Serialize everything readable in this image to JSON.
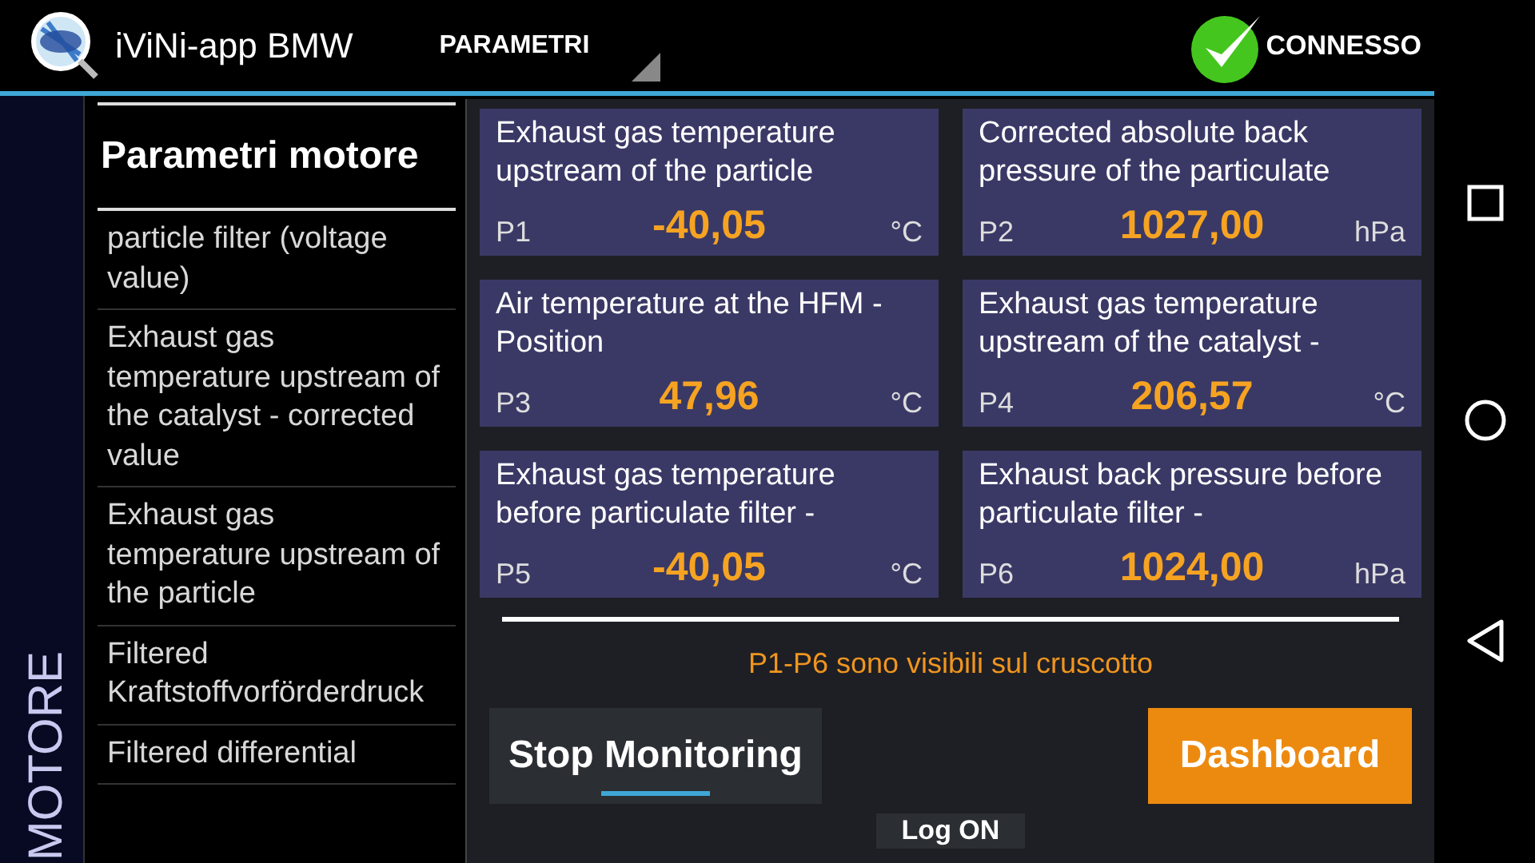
{
  "app_bar": {
    "title": "iViNi-app BMW",
    "menu": "PARAMETRI",
    "status": "CONNESSO"
  },
  "side_tab": "MOTORE",
  "list": {
    "header": "Parametri motore",
    "items": [
      {
        "label": "particle filter (voltage value)"
      },
      {
        "label": "Exhaust gas temperature upstream of the catalyst - corrected value"
      },
      {
        "label": "Exhaust gas temperature upstream of the particle"
      },
      {
        "label": "Filtered Kraftstoffvorförderdruck"
      },
      {
        "label": "Filtered differential"
      }
    ]
  },
  "cards": [
    {
      "name": "Exhaust gas temperature upstream of the particle",
      "slot": "P1",
      "value": "-40,05",
      "unit": "°C"
    },
    {
      "name": "Corrected absolute back pressure of the particulate",
      "slot": "P2",
      "value": "1027,00",
      "unit": "hPa"
    },
    {
      "name": "Air temperature at the HFM - Position",
      "slot": "P3",
      "value": "47,96",
      "unit": "°C"
    },
    {
      "name": "Exhaust gas temperature upstream of the catalyst -",
      "slot": "P4",
      "value": "206,57",
      "unit": "°C"
    },
    {
      "name": "Exhaust gas temperature before particulate filter -",
      "slot": "P5",
      "value": "-40,05",
      "unit": "°C"
    },
    {
      "name": "Exhaust back pressure before particulate filter -",
      "slot": "P6",
      "value": "1024,00",
      "unit": "hPa"
    }
  ],
  "note": "P1-P6 sono visibili sul cruscotto",
  "buttons": {
    "stop": "Stop Monitoring",
    "dashboard": "Dashboard",
    "log": "Log ON"
  }
}
